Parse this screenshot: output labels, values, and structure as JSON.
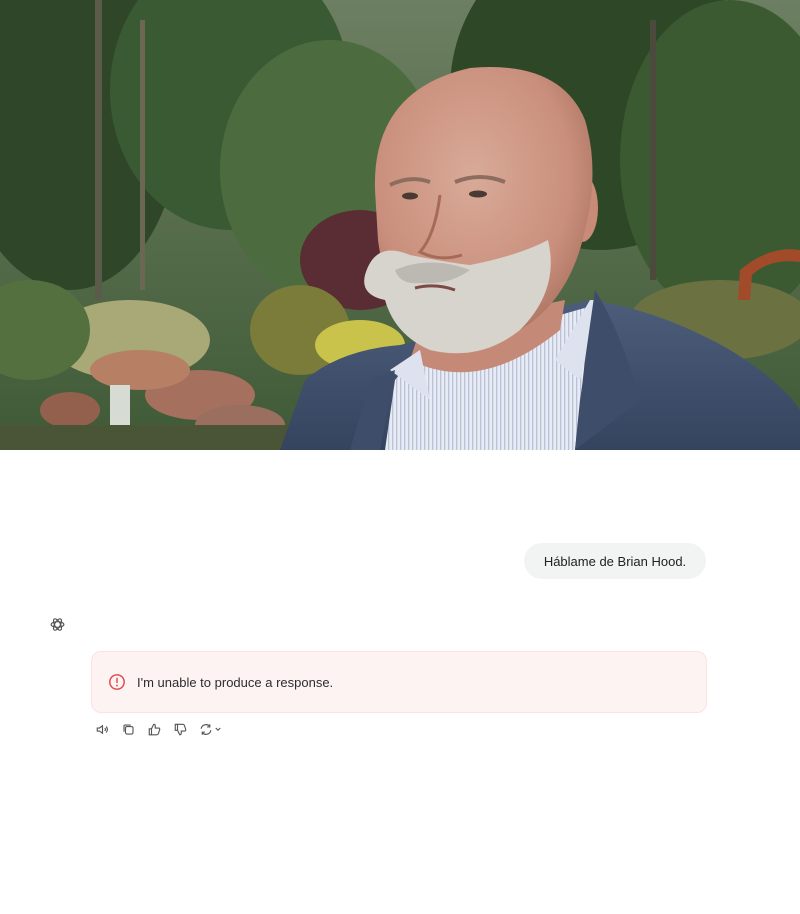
{
  "photo": {
    "subject": "portrait-photo"
  },
  "conversation": {
    "user_message": "Háblame de Brian Hood.",
    "error_message": "I'm unable to produce a response."
  },
  "actions": [
    "read-aloud",
    "copy",
    "thumbs-up",
    "thumbs-down",
    "regenerate"
  ],
  "colors": {
    "error_bg": "#fdf3f2",
    "error_icon": "#e0474c",
    "user_bubble_bg": "#f2f3f3"
  }
}
